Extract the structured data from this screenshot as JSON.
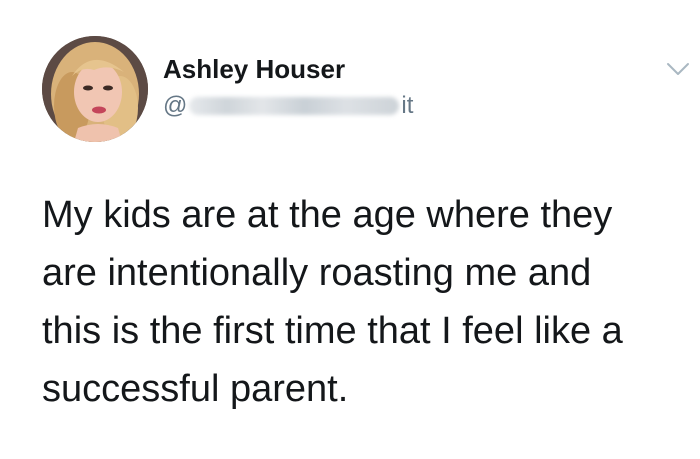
{
  "author": {
    "display_name": "Ashley Houser",
    "handle_prefix": "@",
    "handle_suffix": "it",
    "avatar_icon": "profile-photo"
  },
  "tweet": {
    "lines": [
      "My kids are at the age where they",
      "are intentionally roasting me and",
      "this is the first time that I feel like a",
      "successful parent."
    ]
  },
  "menu": {
    "icon": "chevron-down-icon"
  },
  "colors": {
    "text": "#14171a",
    "secondary": "#657786",
    "background": "#ffffff"
  }
}
